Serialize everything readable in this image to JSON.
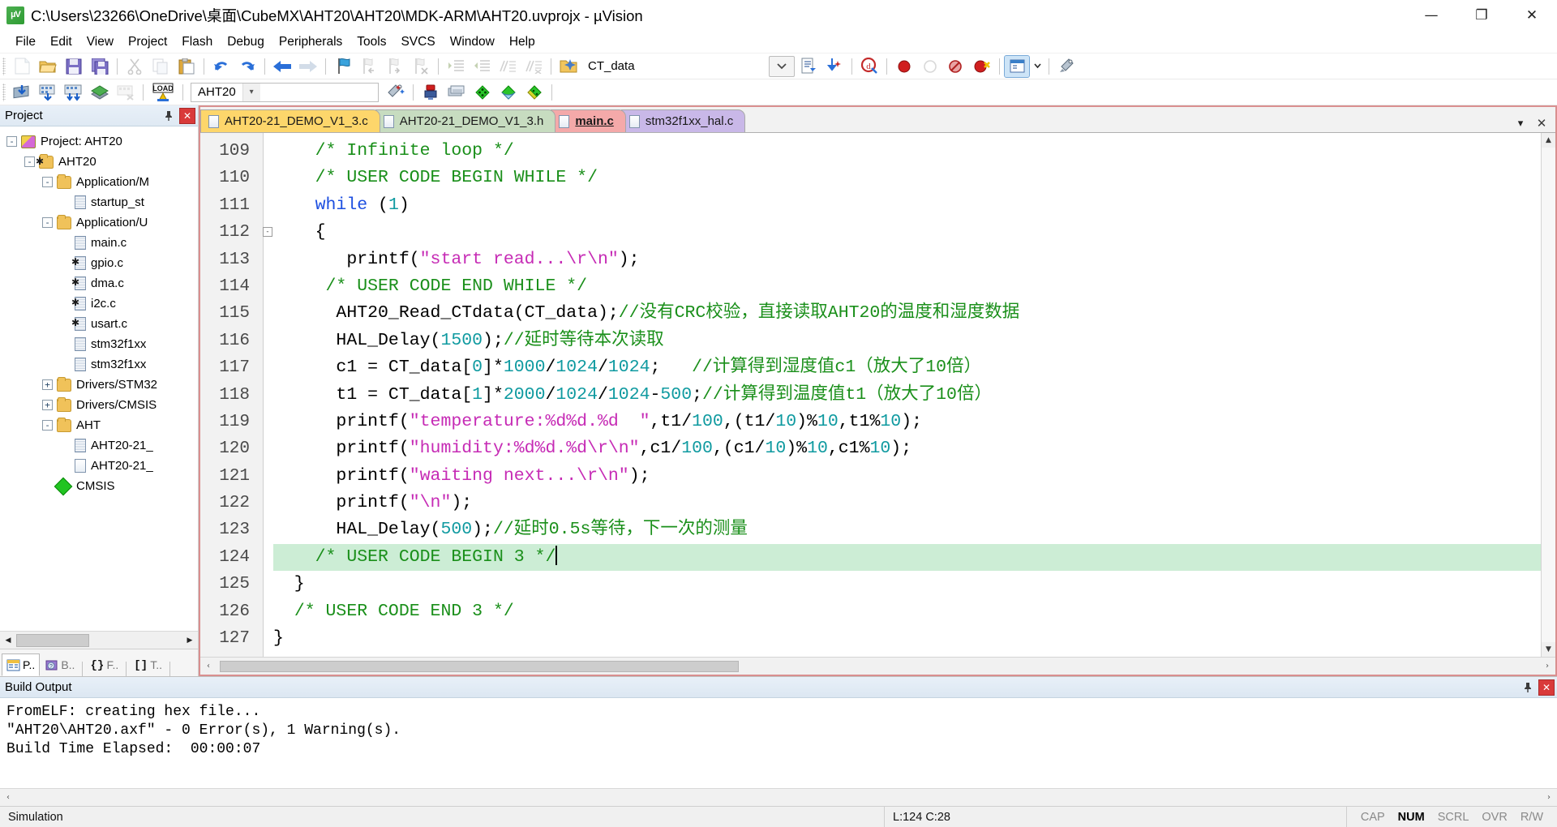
{
  "window": {
    "title": "C:\\Users\\23266\\OneDrive\\桌面\\CubeMX\\AHT20\\AHT20\\MDK-ARM\\AHT20.uvprojx - µVision",
    "app_icon": "uvision-icon",
    "controls": {
      "minimize": "—",
      "maximize": "❐",
      "close": "✕"
    }
  },
  "menu": {
    "items": [
      "File",
      "Edit",
      "View",
      "Project",
      "Flash",
      "Debug",
      "Peripherals",
      "Tools",
      "SVCS",
      "Window",
      "Help"
    ]
  },
  "toolbar1": {
    "icons": [
      {
        "name": "new-file-icon",
        "enabled": false
      },
      {
        "name": "open-file-icon",
        "enabled": true
      },
      {
        "name": "save-icon",
        "enabled": true
      },
      {
        "name": "save-all-icon",
        "enabled": true
      },
      {
        "name": "cut-icon",
        "enabled": false
      },
      {
        "name": "copy-icon",
        "enabled": false
      },
      {
        "name": "paste-icon",
        "enabled": true
      },
      {
        "name": "undo-icon",
        "enabled": true
      },
      {
        "name": "redo-icon",
        "enabled": true
      },
      {
        "name": "navigate-back-icon",
        "enabled": true
      },
      {
        "name": "navigate-forward-icon",
        "enabled": false
      },
      {
        "name": "bookmark-toggle-icon",
        "enabled": true
      },
      {
        "name": "bookmark-prev-icon",
        "enabled": false
      },
      {
        "name": "bookmark-next-icon",
        "enabled": false
      },
      {
        "name": "bookmark-clear-icon",
        "enabled": false
      },
      {
        "name": "indent-icon",
        "enabled": false
      },
      {
        "name": "outdent-icon",
        "enabled": false
      },
      {
        "name": "comment-icon",
        "enabled": false
      },
      {
        "name": "uncomment-icon",
        "enabled": false
      },
      {
        "name": "find-in-files-icon",
        "enabled": true
      }
    ],
    "search_value": "CT_data",
    "search_placeholder": "",
    "right_icons": [
      {
        "name": "insert-bookmark-list-icon",
        "enabled": true
      },
      {
        "name": "go-to-definition-icon",
        "enabled": true
      },
      {
        "name": "start-debug-session-icon",
        "enabled": true
      },
      {
        "name": "insert-breakpoint-icon",
        "enabled": true
      },
      {
        "name": "kill-breakpoint-icon",
        "enabled": false
      },
      {
        "name": "disable-breakpoint-icon",
        "enabled": true
      },
      {
        "name": "kill-all-breakpoints-icon",
        "enabled": true
      },
      {
        "name": "window-layout-icon",
        "enabled": true
      },
      {
        "name": "configuration-wizard-icon",
        "enabled": true
      }
    ]
  },
  "toolbar2": {
    "icons": [
      {
        "name": "translate-icon",
        "enabled": true
      },
      {
        "name": "build-icon",
        "enabled": true
      },
      {
        "name": "rebuild-icon",
        "enabled": true
      },
      {
        "name": "batch-build-icon",
        "enabled": true
      },
      {
        "name": "stop-build-icon",
        "enabled": false
      },
      {
        "name": "load-flash-icon",
        "enabled": true
      }
    ],
    "target_value": "AHT20",
    "right_icons": [
      {
        "name": "target-options-icon",
        "enabled": true
      },
      {
        "name": "manage-runtime-env-icon",
        "enabled": true
      },
      {
        "name": "pack-installer-icon",
        "enabled": true
      },
      {
        "name": "manage-project-items-icon",
        "enabled": true
      },
      {
        "name": "components-icon",
        "enabled": true
      },
      {
        "name": "select-software-packs-icon",
        "enabled": true
      },
      {
        "name": "manage-run-time-icon",
        "enabled": true
      }
    ]
  },
  "project_pane": {
    "title": "Project",
    "pin_icon": "pin-icon",
    "close_icon": "close-icon",
    "tree": [
      {
        "label": "Project: AHT20",
        "depth": 0,
        "expander": "-",
        "icon": "project-icon"
      },
      {
        "label": "AHT20",
        "depth": 1,
        "expander": "-",
        "icon": "target-folder-icon"
      },
      {
        "label": "Application/M",
        "depth": 2,
        "expander": "-",
        "icon": "folder-open-icon"
      },
      {
        "label": "startup_st",
        "depth": 3,
        "expander": "",
        "icon": "file-hatched-icon"
      },
      {
        "label": "Application/U",
        "depth": 2,
        "expander": "-",
        "icon": "folder-open-icon"
      },
      {
        "label": "main.c",
        "depth": 3,
        "expander": "",
        "icon": "file-hatched-icon"
      },
      {
        "label": "gpio.c",
        "depth": 3,
        "expander": "",
        "icon": "file-star-icon"
      },
      {
        "label": "dma.c",
        "depth": 3,
        "expander": "",
        "icon": "file-star-icon"
      },
      {
        "label": "i2c.c",
        "depth": 3,
        "expander": "",
        "icon": "file-star-icon"
      },
      {
        "label": "usart.c",
        "depth": 3,
        "expander": "",
        "icon": "file-star-icon"
      },
      {
        "label": "stm32f1xx",
        "depth": 3,
        "expander": "",
        "icon": "file-hatched-icon"
      },
      {
        "label": "stm32f1xx",
        "depth": 3,
        "expander": "",
        "icon": "file-hatched-icon"
      },
      {
        "label": "Drivers/STM32",
        "depth": 2,
        "expander": "+",
        "icon": "folder-icon"
      },
      {
        "label": "Drivers/CMSIS",
        "depth": 2,
        "expander": "+",
        "icon": "folder-icon"
      },
      {
        "label": "AHT",
        "depth": 2,
        "expander": "-",
        "icon": "folder-open-icon"
      },
      {
        "label": "AHT20-21_",
        "depth": 3,
        "expander": "",
        "icon": "file-hatched-icon"
      },
      {
        "label": "AHT20-21_",
        "depth": 3,
        "expander": "",
        "icon": "file-plain-icon"
      },
      {
        "label": "CMSIS",
        "depth": 2,
        "expander": "",
        "icon": "cmsis-diamond-icon"
      }
    ],
    "tabs": [
      {
        "label": "P..",
        "icon": "project-tab-icon",
        "active": true
      },
      {
        "label": "B..",
        "icon": "books-tab-icon",
        "active": false
      },
      {
        "label": "F..",
        "icon": "functions-tab-icon",
        "active": false
      },
      {
        "label": "T..",
        "icon": "templates-tab-icon",
        "active": false
      }
    ]
  },
  "editor": {
    "tabs": [
      {
        "label": "AHT20-21_DEMO_V1_3.c",
        "active": false
      },
      {
        "label": "AHT20-21_DEMO_V1_3.h",
        "active": false
      },
      {
        "label": "main.c",
        "active": true
      },
      {
        "label": "stm32f1xx_hal.c",
        "active": false
      }
    ],
    "tab_buttons": [
      {
        "name": "tab-list-dropdown",
        "glyph": "▾"
      },
      {
        "name": "close-tab-button",
        "glyph": "✕"
      }
    ],
    "first_line_number": 109,
    "lines": [
      {
        "n": 109,
        "fold": "",
        "highlight": false,
        "tokens": [
          {
            "t": "    ",
            "c": ""
          },
          {
            "t": "/* Infinite loop */",
            "c": "cm"
          }
        ]
      },
      {
        "n": 110,
        "fold": "",
        "highlight": false,
        "tokens": [
          {
            "t": "    ",
            "c": ""
          },
          {
            "t": "/* USER CODE BEGIN WHILE */",
            "c": "cm"
          }
        ]
      },
      {
        "n": 111,
        "fold": "",
        "highlight": false,
        "tokens": [
          {
            "t": "    ",
            "c": ""
          },
          {
            "t": "while",
            "c": "kw"
          },
          {
            "t": " (",
            "c": ""
          },
          {
            "t": "1",
            "c": "num"
          },
          {
            "t": ")",
            "c": ""
          }
        ]
      },
      {
        "n": 112,
        "fold": "-",
        "highlight": false,
        "tokens": [
          {
            "t": "    {",
            "c": ""
          }
        ]
      },
      {
        "n": 113,
        "fold": "",
        "highlight": false,
        "tokens": [
          {
            "t": "       printf(",
            "c": ""
          },
          {
            "t": "\"start read...\\r\\n\"",
            "c": "str"
          },
          {
            "t": ");",
            "c": ""
          }
        ]
      },
      {
        "n": 114,
        "fold": "",
        "highlight": false,
        "tokens": [
          {
            "t": "     ",
            "c": ""
          },
          {
            "t": "/* USER CODE END WHILE */",
            "c": "cm"
          }
        ]
      },
      {
        "n": 115,
        "fold": "",
        "highlight": false,
        "tokens": [
          {
            "t": "      AHT20_Read_CTdata(CT_data);",
            "c": ""
          },
          {
            "t": "//没有CRC校验，直接读取AHT20的温度和湿度数据",
            "c": "cm"
          }
        ]
      },
      {
        "n": 116,
        "fold": "",
        "highlight": false,
        "tokens": [
          {
            "t": "      HAL_Delay(",
            "c": ""
          },
          {
            "t": "1500",
            "c": "num"
          },
          {
            "t": ");",
            "c": ""
          },
          {
            "t": "//延时等待本次读取",
            "c": "cm"
          }
        ]
      },
      {
        "n": 117,
        "fold": "",
        "highlight": false,
        "tokens": [
          {
            "t": "      c1 = CT_data[",
            "c": ""
          },
          {
            "t": "0",
            "c": "num"
          },
          {
            "t": "]*",
            "c": ""
          },
          {
            "t": "1000",
            "c": "num"
          },
          {
            "t": "/",
            "c": ""
          },
          {
            "t": "1024",
            "c": "num"
          },
          {
            "t": "/",
            "c": ""
          },
          {
            "t": "1024",
            "c": "num"
          },
          {
            "t": ";   ",
            "c": ""
          },
          {
            "t": "//计算得到湿度值c1（放大了10倍）",
            "c": "cm"
          }
        ]
      },
      {
        "n": 118,
        "fold": "",
        "highlight": false,
        "tokens": [
          {
            "t": "      t1 = CT_data[",
            "c": ""
          },
          {
            "t": "1",
            "c": "num"
          },
          {
            "t": "]*",
            "c": ""
          },
          {
            "t": "2000",
            "c": "num"
          },
          {
            "t": "/",
            "c": ""
          },
          {
            "t": "1024",
            "c": "num"
          },
          {
            "t": "/",
            "c": ""
          },
          {
            "t": "1024",
            "c": "num"
          },
          {
            "t": "-",
            "c": ""
          },
          {
            "t": "500",
            "c": "num"
          },
          {
            "t": ";",
            "c": ""
          },
          {
            "t": "//计算得到温度值t1（放大了10倍）",
            "c": "cm"
          }
        ]
      },
      {
        "n": 119,
        "fold": "",
        "highlight": false,
        "tokens": [
          {
            "t": "      printf(",
            "c": ""
          },
          {
            "t": "\"temperature:%d%d.%d  \"",
            "c": "str"
          },
          {
            "t": ",t1/",
            "c": ""
          },
          {
            "t": "100",
            "c": "num"
          },
          {
            "t": ",(t1/",
            "c": ""
          },
          {
            "t": "10",
            "c": "num"
          },
          {
            "t": ")%",
            "c": ""
          },
          {
            "t": "10",
            "c": "num"
          },
          {
            "t": ",t1%",
            "c": ""
          },
          {
            "t": "10",
            "c": "num"
          },
          {
            "t": ");",
            "c": ""
          }
        ]
      },
      {
        "n": 120,
        "fold": "",
        "highlight": false,
        "tokens": [
          {
            "t": "      printf(",
            "c": ""
          },
          {
            "t": "\"humidity:%d%d.%d\\r\\n\"",
            "c": "str"
          },
          {
            "t": ",c1/",
            "c": ""
          },
          {
            "t": "100",
            "c": "num"
          },
          {
            "t": ",(c1/",
            "c": ""
          },
          {
            "t": "10",
            "c": "num"
          },
          {
            "t": ")%",
            "c": ""
          },
          {
            "t": "10",
            "c": "num"
          },
          {
            "t": ",c1%",
            "c": ""
          },
          {
            "t": "10",
            "c": "num"
          },
          {
            "t": ");",
            "c": ""
          }
        ]
      },
      {
        "n": 121,
        "fold": "",
        "highlight": false,
        "tokens": [
          {
            "t": "      printf(",
            "c": ""
          },
          {
            "t": "\"waiting next...\\r\\n\"",
            "c": "str"
          },
          {
            "t": ");",
            "c": ""
          }
        ]
      },
      {
        "n": 122,
        "fold": "",
        "highlight": false,
        "tokens": [
          {
            "t": "      printf(",
            "c": ""
          },
          {
            "t": "\"\\n\"",
            "c": "str"
          },
          {
            "t": ");",
            "c": ""
          }
        ]
      },
      {
        "n": 123,
        "fold": "",
        "highlight": false,
        "tokens": [
          {
            "t": "      HAL_Delay(",
            "c": ""
          },
          {
            "t": "500",
            "c": "num"
          },
          {
            "t": ");",
            "c": ""
          },
          {
            "t": "//延时0.5s等待，下一次的测量",
            "c": "cm"
          }
        ]
      },
      {
        "n": 124,
        "fold": "",
        "highlight": true,
        "tokens": [
          {
            "t": "    ",
            "c": ""
          },
          {
            "t": "/* USER CODE BEGIN 3 */",
            "c": "cm"
          },
          {
            "t": "|CARET|",
            "c": "caret"
          }
        ]
      },
      {
        "n": 125,
        "fold": "",
        "highlight": false,
        "tokens": [
          {
            "t": "  }",
            "c": ""
          }
        ]
      },
      {
        "n": 126,
        "fold": "",
        "highlight": false,
        "tokens": [
          {
            "t": "  ",
            "c": ""
          },
          {
            "t": "/* USER CODE END 3 */",
            "c": "cm"
          }
        ]
      },
      {
        "n": 127,
        "fold": "",
        "highlight": false,
        "tokens": [
          {
            "t": "}",
            "c": ""
          }
        ]
      }
    ]
  },
  "build_output": {
    "title": "Build Output",
    "pin_icon": "pin-icon",
    "close_icon": "close-icon",
    "lines": [
      "FromELF: creating hex file...",
      "\"AHT20\\AHT20.axf\" - 0 Error(s), 1 Warning(s).",
      "Build Time Elapsed:  00:00:07"
    ]
  },
  "statusbar": {
    "simulation": "Simulation",
    "cursor": "L:124 C:28",
    "indicators": [
      {
        "label": "CAP",
        "on": false
      },
      {
        "label": "NUM",
        "on": true
      },
      {
        "label": "SCRL",
        "on": false
      },
      {
        "label": "OVR",
        "on": false
      },
      {
        "label": "R/W",
        "on": false
      }
    ]
  },
  "colors": {
    "comment": "#1a8f1a",
    "keyword": "#1d4fe0",
    "number": "#0f9aa0",
    "string": "#c62bb5",
    "highlight_line": "#ccedd5",
    "tab_c": "#fdd66b",
    "tab_h": "#c7dcc0",
    "tab_main": "#f4a9a9",
    "tab_hal": "#c9b8e8",
    "editor_border": "#d98f8f"
  }
}
